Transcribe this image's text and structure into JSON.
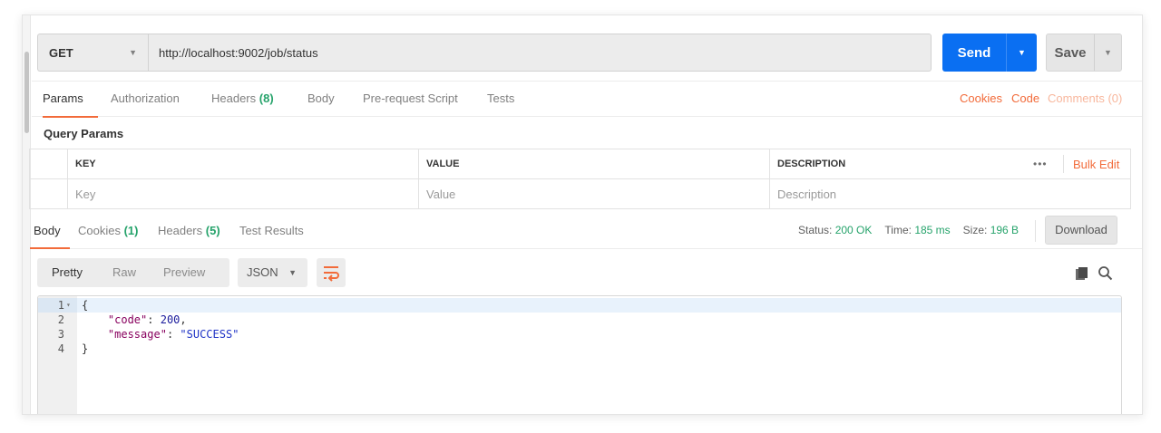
{
  "request": {
    "method": "GET",
    "url": "http://localhost:9002/job/status",
    "send_label": "Send",
    "save_label": "Save"
  },
  "request_tabs": [
    {
      "label": "Params",
      "count": ""
    },
    {
      "label": "Authorization",
      "count": ""
    },
    {
      "label": "Headers",
      "count": "(8)"
    },
    {
      "label": "Body",
      "count": ""
    },
    {
      "label": "Pre-request Script",
      "count": ""
    },
    {
      "label": "Tests",
      "count": ""
    }
  ],
  "request_links": {
    "cookies": "Cookies",
    "code": "Code",
    "comments": "Comments (0)"
  },
  "query_params": {
    "title": "Query Params",
    "columns": [
      "KEY",
      "VALUE",
      "DESCRIPTION"
    ],
    "placeholders": [
      "Key",
      "Value",
      "Description"
    ],
    "dots": "•••",
    "bulk_edit": "Bulk Edit"
  },
  "response_tabs": [
    {
      "label": "Body",
      "count": ""
    },
    {
      "label": "Cookies",
      "count": "(1)"
    },
    {
      "label": "Headers",
      "count": "(5)"
    },
    {
      "label": "Test Results",
      "count": ""
    }
  ],
  "status": {
    "status_label": "Status:",
    "status_value": "200 OK",
    "time_label": "Time:",
    "time_value": "185 ms",
    "size_label": "Size:",
    "size_value": "196 B",
    "download_label": "Download"
  },
  "format": {
    "modes": [
      "Pretty",
      "Raw",
      "Preview"
    ],
    "active_mode": "Pretty",
    "language": "JSON"
  },
  "editor": {
    "lines": [
      {
        "num": "1",
        "fold": "▾",
        "parts": [
          {
            "t": "{",
            "c": "p"
          }
        ]
      },
      {
        "num": "2",
        "fold": "",
        "parts": [
          {
            "t": "    ",
            "c": "p"
          },
          {
            "t": "\"code\"",
            "c": "k"
          },
          {
            "t": ": ",
            "c": "p"
          },
          {
            "t": "200",
            "c": "n"
          },
          {
            "t": ",",
            "c": "p"
          }
        ]
      },
      {
        "num": "3",
        "fold": "",
        "parts": [
          {
            "t": "    ",
            "c": "p"
          },
          {
            "t": "\"message\"",
            "c": "k"
          },
          {
            "t": ": ",
            "c": "p"
          },
          {
            "t": "\"SUCCESS\"",
            "c": "s"
          }
        ]
      },
      {
        "num": "4",
        "fold": "",
        "parts": [
          {
            "t": "}",
            "c": "p"
          }
        ]
      }
    ]
  },
  "colors": {
    "accent": "#f26b3a",
    "primary": "#0a6ff2",
    "success": "#26a36b"
  },
  "icons": {
    "wrap": "wrap-lines-icon",
    "copy": "copy-icon",
    "search": "search-icon"
  }
}
